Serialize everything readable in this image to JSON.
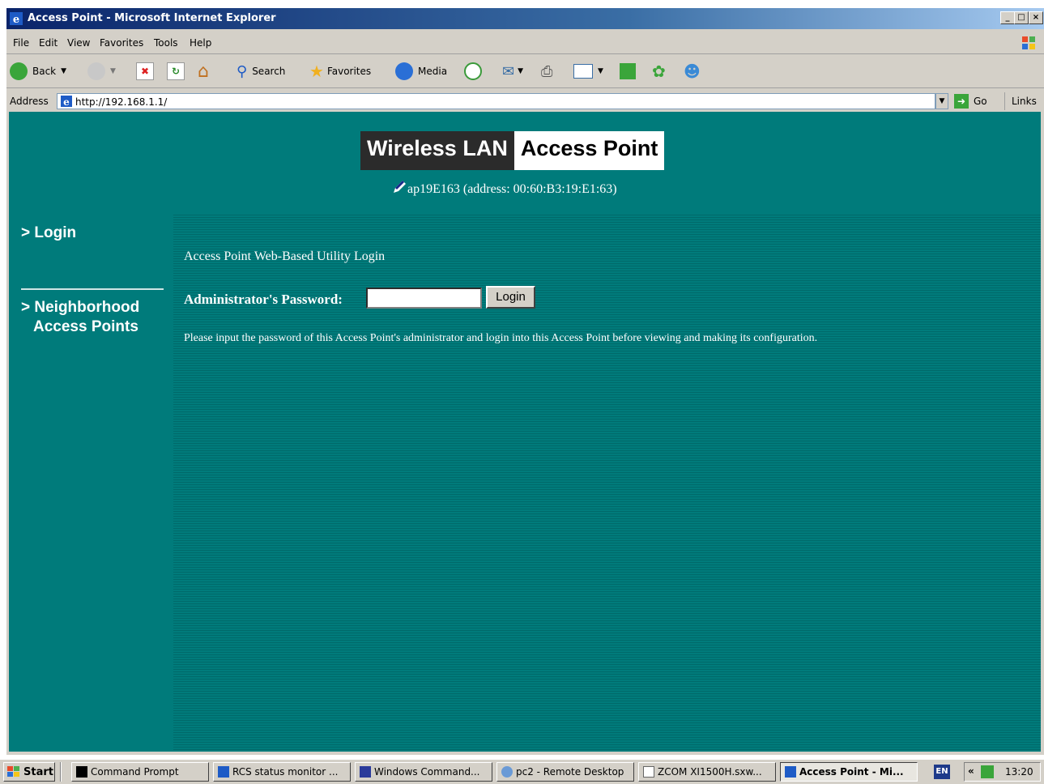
{
  "window": {
    "title": "Access Point - Microsoft Internet Explorer"
  },
  "menubar": {
    "items": [
      "File",
      "Edit",
      "View",
      "Favorites",
      "Tools",
      "Help"
    ]
  },
  "toolbar": {
    "back": "Back",
    "search": "Search",
    "favorites": "Favorites",
    "media": "Media"
  },
  "addressbar": {
    "label": "Address",
    "url": "http://192.168.1.1/",
    "go": "Go",
    "links": "Links"
  },
  "page": {
    "logo_left": "Wireless LAN",
    "logo_right": "Access Point",
    "ap_info": "ap19E163 (address: 00:60:B3:19:E1:63)",
    "nav": {
      "login": "> Login",
      "neighborhood_line1": "> Neighborhood",
      "neighborhood_line2": "Access Points"
    },
    "main": {
      "heading": "Access Point Web-Based Utility Login",
      "password_label": "Administrator's Password:",
      "password_value": "",
      "login_button": "Login",
      "instructions": "Please input the password of this Access Point's administrator and login into this Access Point before viewing and making its configuration."
    }
  },
  "taskbar": {
    "start": "Start",
    "tasks": [
      "Command Prompt",
      "RCS status monitor ...",
      "Windows Command...",
      "pc2 - Remote Desktop",
      "ZCOM XI1500H.sxw...",
      "Access Point - Mi..."
    ],
    "lang": "EN",
    "clock": "13:20"
  },
  "colors": {
    "page_bg": "#007b7b",
    "title_bar": "#0a246a",
    "chrome": "#d4d0c8"
  }
}
